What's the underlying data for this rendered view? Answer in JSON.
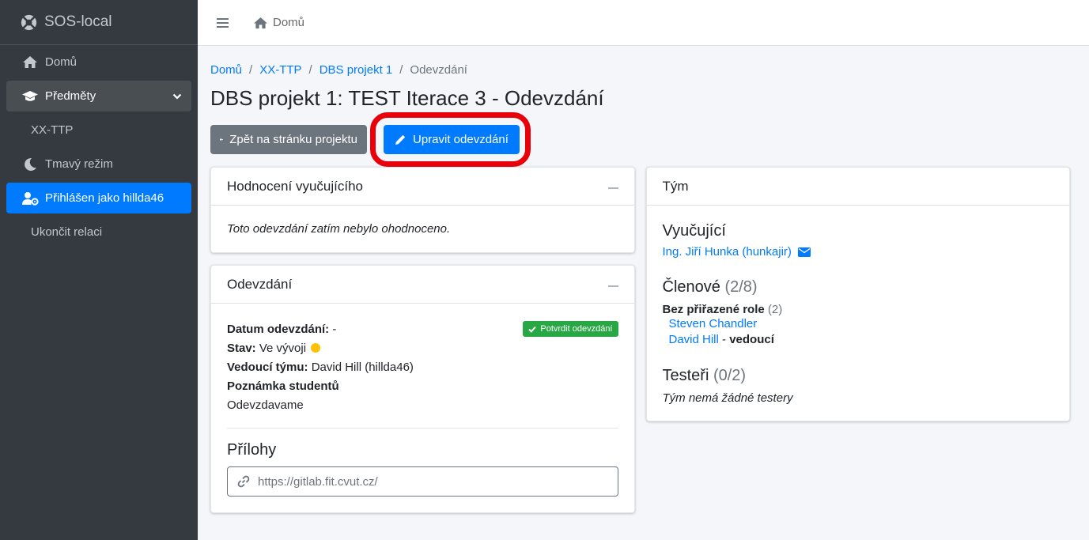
{
  "brand": {
    "name": "SOS-local"
  },
  "sidebar": {
    "items": [
      {
        "label": "Domů"
      },
      {
        "label": "Předměty"
      },
      {
        "label": "XX-TTP"
      },
      {
        "label": "Tmavý režim"
      },
      {
        "label": "Přihlášen jako hillda46"
      },
      {
        "label": "Ukončit relaci"
      }
    ]
  },
  "topbar": {
    "home_label": "Domů"
  },
  "breadcrumb": [
    "Domů",
    "XX-TTP",
    "DBS projekt 1",
    "Odevzdání"
  ],
  "page": {
    "title": "DBS projekt 1: TEST Iterace 3 - Odevzdání",
    "back_label": "Zpět na stránku projektu",
    "edit_label": "Upravit odevzdání"
  },
  "rating": {
    "header": "Hodnocení vyučujícího",
    "text": "Toto odevzdání zatím nebylo ohodnoceno."
  },
  "submission": {
    "header": "Odevzdání",
    "confirm_badge": "Potvrdit odevzdání",
    "date_label": "Datum odevzdání:",
    "date_value": "-",
    "state_label": "Stav:",
    "state_value": "Ve vývoji",
    "leader_label": "Vedoucí týmu:",
    "leader_value": "David Hill (hillda46)",
    "note_label": "Poznámka studentů",
    "note_value": "Odevzdavame",
    "attachments_title": "Přílohy",
    "attachment_url": "https://gitlab.fit.cvut.cz/"
  },
  "team": {
    "header": "Tým",
    "teachers_title": "Vyučující",
    "teacher_name": "Ing. Jiří Hunka (hunkajir)",
    "members_title": "Členové",
    "members_count": "(2/8)",
    "role_label": "Bez přiřazené role",
    "role_count": "(2)",
    "members": [
      {
        "name": "Steven Chandler",
        "dash": "",
        "role": ""
      },
      {
        "name": "David Hill",
        "dash": " - ",
        "role": "vedoucí"
      }
    ],
    "testers_title": "Testeři",
    "testers_count": "(0/2)",
    "no_testers": "Tým nemá žádné testery"
  }
}
